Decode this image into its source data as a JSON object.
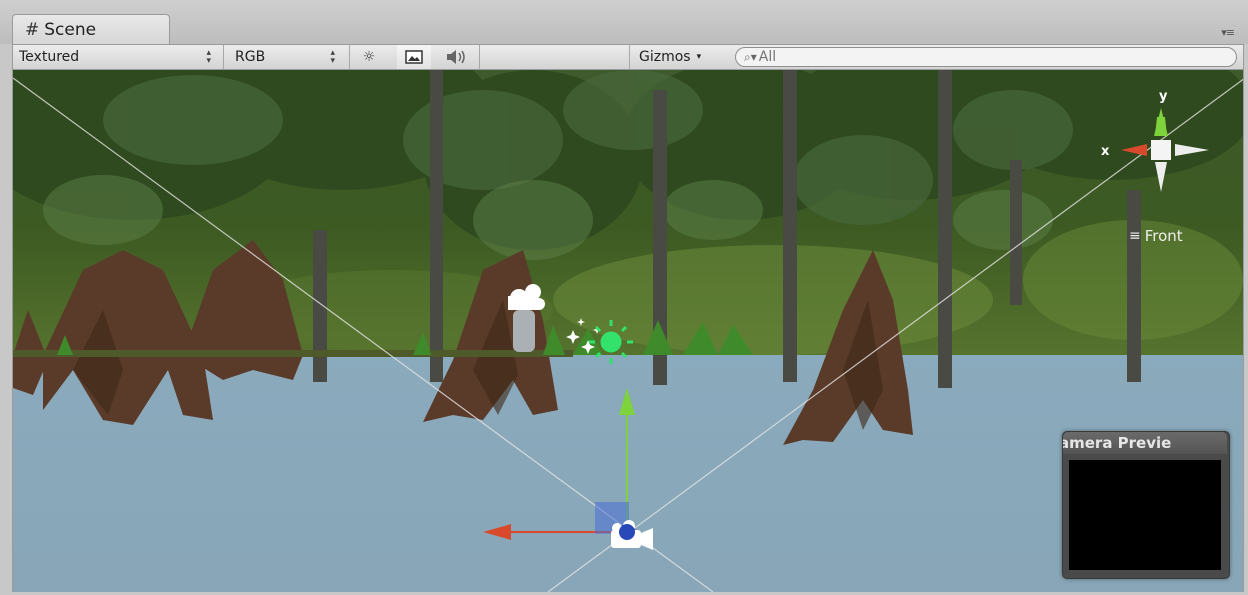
{
  "tab": {
    "title": "Scene"
  },
  "toolbar": {
    "render_mode": "Textured",
    "channel_mode": "RGB",
    "gizmos_label": "Gizmos",
    "search_placeholder": "All"
  },
  "orientation_gizmo": {
    "x_label": "x",
    "y_label": "y",
    "view_label": "Front"
  },
  "camera_preview": {
    "title": "amera Previe"
  },
  "colors": {
    "sky_water": "#87a6b8",
    "gizmo_x": "#d94a2c",
    "gizmo_y": "#7ed23c",
    "light_gizmo": "#33e26a"
  }
}
